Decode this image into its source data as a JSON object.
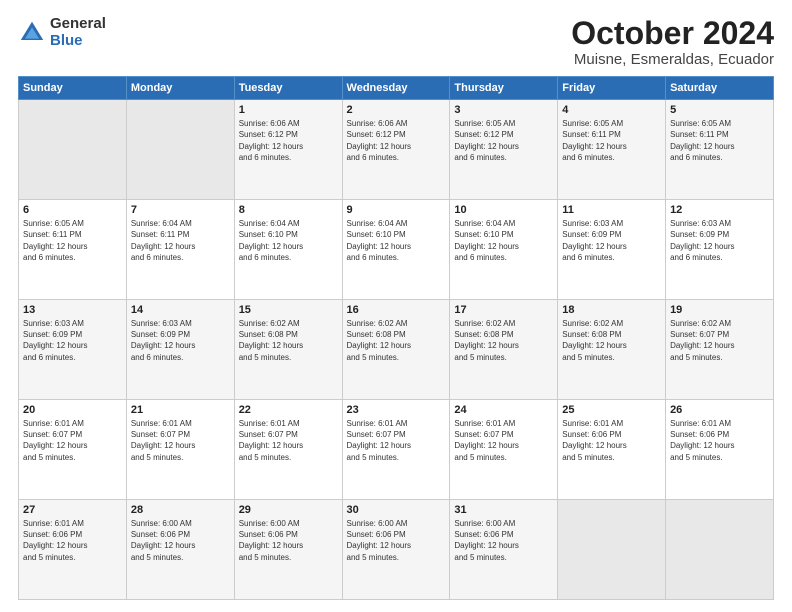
{
  "logo": {
    "general": "General",
    "blue": "Blue"
  },
  "title": {
    "month": "October 2024",
    "location": "Muisne, Esmeraldas, Ecuador"
  },
  "days_header": [
    "Sunday",
    "Monday",
    "Tuesday",
    "Wednesday",
    "Thursday",
    "Friday",
    "Saturday"
  ],
  "weeks": [
    [
      {
        "day": "",
        "info": ""
      },
      {
        "day": "",
        "info": ""
      },
      {
        "day": "1",
        "info": "Sunrise: 6:06 AM\nSunset: 6:12 PM\nDaylight: 12 hours\nand 6 minutes."
      },
      {
        "day": "2",
        "info": "Sunrise: 6:06 AM\nSunset: 6:12 PM\nDaylight: 12 hours\nand 6 minutes."
      },
      {
        "day": "3",
        "info": "Sunrise: 6:05 AM\nSunset: 6:12 PM\nDaylight: 12 hours\nand 6 minutes."
      },
      {
        "day": "4",
        "info": "Sunrise: 6:05 AM\nSunset: 6:11 PM\nDaylight: 12 hours\nand 6 minutes."
      },
      {
        "day": "5",
        "info": "Sunrise: 6:05 AM\nSunset: 6:11 PM\nDaylight: 12 hours\nand 6 minutes."
      }
    ],
    [
      {
        "day": "6",
        "info": "Sunrise: 6:05 AM\nSunset: 6:11 PM\nDaylight: 12 hours\nand 6 minutes."
      },
      {
        "day": "7",
        "info": "Sunrise: 6:04 AM\nSunset: 6:11 PM\nDaylight: 12 hours\nand 6 minutes."
      },
      {
        "day": "8",
        "info": "Sunrise: 6:04 AM\nSunset: 6:10 PM\nDaylight: 12 hours\nand 6 minutes."
      },
      {
        "day": "9",
        "info": "Sunrise: 6:04 AM\nSunset: 6:10 PM\nDaylight: 12 hours\nand 6 minutes."
      },
      {
        "day": "10",
        "info": "Sunrise: 6:04 AM\nSunset: 6:10 PM\nDaylight: 12 hours\nand 6 minutes."
      },
      {
        "day": "11",
        "info": "Sunrise: 6:03 AM\nSunset: 6:09 PM\nDaylight: 12 hours\nand 6 minutes."
      },
      {
        "day": "12",
        "info": "Sunrise: 6:03 AM\nSunset: 6:09 PM\nDaylight: 12 hours\nand 6 minutes."
      }
    ],
    [
      {
        "day": "13",
        "info": "Sunrise: 6:03 AM\nSunset: 6:09 PM\nDaylight: 12 hours\nand 6 minutes."
      },
      {
        "day": "14",
        "info": "Sunrise: 6:03 AM\nSunset: 6:09 PM\nDaylight: 12 hours\nand 6 minutes."
      },
      {
        "day": "15",
        "info": "Sunrise: 6:02 AM\nSunset: 6:08 PM\nDaylight: 12 hours\nand 5 minutes."
      },
      {
        "day": "16",
        "info": "Sunrise: 6:02 AM\nSunset: 6:08 PM\nDaylight: 12 hours\nand 5 minutes."
      },
      {
        "day": "17",
        "info": "Sunrise: 6:02 AM\nSunset: 6:08 PM\nDaylight: 12 hours\nand 5 minutes."
      },
      {
        "day": "18",
        "info": "Sunrise: 6:02 AM\nSunset: 6:08 PM\nDaylight: 12 hours\nand 5 minutes."
      },
      {
        "day": "19",
        "info": "Sunrise: 6:02 AM\nSunset: 6:07 PM\nDaylight: 12 hours\nand 5 minutes."
      }
    ],
    [
      {
        "day": "20",
        "info": "Sunrise: 6:01 AM\nSunset: 6:07 PM\nDaylight: 12 hours\nand 5 minutes."
      },
      {
        "day": "21",
        "info": "Sunrise: 6:01 AM\nSunset: 6:07 PM\nDaylight: 12 hours\nand 5 minutes."
      },
      {
        "day": "22",
        "info": "Sunrise: 6:01 AM\nSunset: 6:07 PM\nDaylight: 12 hours\nand 5 minutes."
      },
      {
        "day": "23",
        "info": "Sunrise: 6:01 AM\nSunset: 6:07 PM\nDaylight: 12 hours\nand 5 minutes."
      },
      {
        "day": "24",
        "info": "Sunrise: 6:01 AM\nSunset: 6:07 PM\nDaylight: 12 hours\nand 5 minutes."
      },
      {
        "day": "25",
        "info": "Sunrise: 6:01 AM\nSunset: 6:06 PM\nDaylight: 12 hours\nand 5 minutes."
      },
      {
        "day": "26",
        "info": "Sunrise: 6:01 AM\nSunset: 6:06 PM\nDaylight: 12 hours\nand 5 minutes."
      }
    ],
    [
      {
        "day": "27",
        "info": "Sunrise: 6:01 AM\nSunset: 6:06 PM\nDaylight: 12 hours\nand 5 minutes."
      },
      {
        "day": "28",
        "info": "Sunrise: 6:00 AM\nSunset: 6:06 PM\nDaylight: 12 hours\nand 5 minutes."
      },
      {
        "day": "29",
        "info": "Sunrise: 6:00 AM\nSunset: 6:06 PM\nDaylight: 12 hours\nand 5 minutes."
      },
      {
        "day": "30",
        "info": "Sunrise: 6:00 AM\nSunset: 6:06 PM\nDaylight: 12 hours\nand 5 minutes."
      },
      {
        "day": "31",
        "info": "Sunrise: 6:00 AM\nSunset: 6:06 PM\nDaylight: 12 hours\nand 5 minutes."
      },
      {
        "day": "",
        "info": ""
      },
      {
        "day": "",
        "info": ""
      }
    ]
  ]
}
